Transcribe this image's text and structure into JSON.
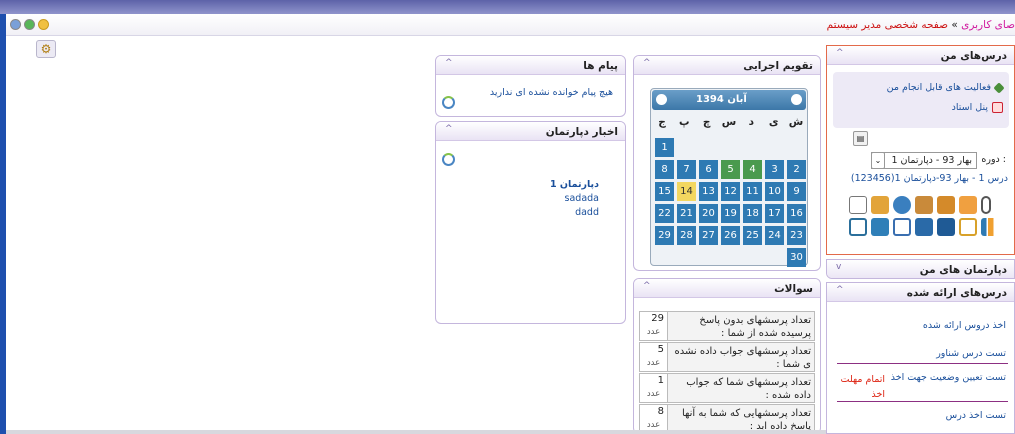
{
  "breadcrumb": {
    "part1": "صای کاربری",
    "sep": "»",
    "part2": "صفحه شخصی مدیر سیستم"
  },
  "my_courses": {
    "title": "درس‌های من",
    "toggle": "^",
    "items": [
      {
        "label": "فعالیت های قابل انجام من",
        "icon": "activity-icon"
      },
      {
        "label": "پنل استاد",
        "icon": "teacher-panel-icon"
      }
    ],
    "period_label": "دوره :",
    "period_value": "بهار 93 - دپارتمان 1",
    "course_link": "درس 1 - بهار 93-دپارتمان 1(123456)",
    "tool_icons_row1": [
      "attach-icon",
      "folder-icon",
      "edit-icon",
      "users-icon",
      "gradebook-icon",
      "people-icon",
      "note-icon"
    ],
    "tool_icons_row2": [
      "chart-icon",
      "ruler-icon",
      "board-icon",
      "calendar-icon",
      "survey-icon",
      "group-icon",
      "check-icon"
    ]
  },
  "departments": {
    "title": "دپارتمان های من",
    "toggle": "v"
  },
  "offered": {
    "title": "درس‌های ارائه شده",
    "toggle": "^",
    "links": [
      "اخذ دروس ارائه شده",
      "تست درس شناور",
      "تست تعیین وضعیت جهت اخذ",
      "تست اخذ درس"
    ],
    "deadline_note": "اتمام مهلت اخذ"
  },
  "calendar": {
    "title": "تقویم اجرایی",
    "toggle": "^",
    "month": "آبان 1394",
    "weekdays": [
      "ش",
      "ی",
      "د",
      "س",
      "چ",
      "پ",
      "ج"
    ],
    "days": [
      "1",
      "2",
      "3",
      "4",
      "5",
      "6",
      "7",
      "8",
      "9",
      "10",
      "11",
      "12",
      "13",
      "14",
      "15",
      "16",
      "17",
      "18",
      "19",
      "20",
      "21",
      "22",
      "23",
      "24",
      "25",
      "26",
      "27",
      "28",
      "29",
      "30"
    ],
    "today": "14",
    "green_days": [
      "4",
      "5"
    ]
  },
  "questions": {
    "title": "سوالات",
    "toggle": "^",
    "unit": "عدد",
    "rows": [
      {
        "text": "تعداد پرسشهای بدون پاسخ پرسیده شده از شما :",
        "value": "29"
      },
      {
        "text": "تعداد پرسشهای جواب داده نشده ی شما :",
        "value": "5"
      },
      {
        "text": "تعداد پرسشهای شما که جواب داده شده :",
        "value": "1"
      },
      {
        "text": "تعداد پرسشهایی که شما به آنها پاسخ داده اید :",
        "value": "8"
      }
    ]
  },
  "messages": {
    "title": "پیام ها",
    "toggle": "^",
    "empty_text": "هیچ پیام خوانده نشده ای ندارید"
  },
  "news": {
    "title": "اخبار دپارتمان",
    "toggle": "^",
    "dept": "دپارتمان 1",
    "items": [
      "sadada",
      "dadd"
    ]
  },
  "colors": {
    "accent": "#1a4f9b",
    "header_bar": "#5d62a8",
    "highlight_border": "#e36a4a",
    "today": "#f3d760",
    "calendar_day": "#2e7ab3"
  }
}
